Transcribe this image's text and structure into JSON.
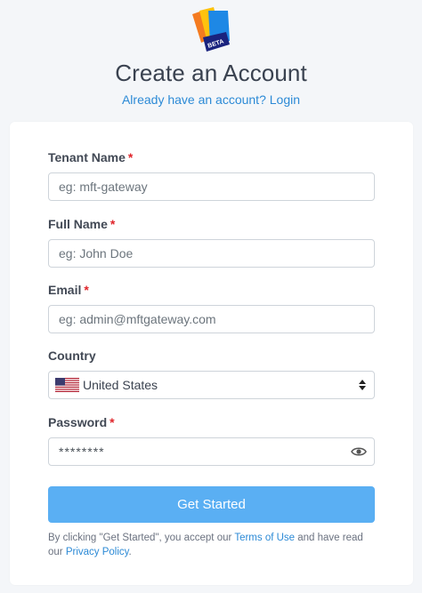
{
  "header": {
    "logo_badge": "BETA",
    "title": "Create an Account",
    "login_text": "Already have an account? Login"
  },
  "form": {
    "tenant": {
      "label": "Tenant Name",
      "required_mark": "*",
      "placeholder": "eg: mft-gateway",
      "value": ""
    },
    "fullname": {
      "label": "Full Name",
      "required_mark": "*",
      "placeholder": "eg: John Doe",
      "value": ""
    },
    "email": {
      "label": "Email",
      "required_mark": "*",
      "placeholder": "eg: admin@mftgateway.com",
      "value": ""
    },
    "country": {
      "label": "Country",
      "selected": "United States",
      "flag_icon": "us-flag-icon"
    },
    "password": {
      "label": "Password",
      "required_mark": "*",
      "placeholder": "********",
      "toggle_icon": "eye-icon"
    },
    "submit_label": "Get Started"
  },
  "terms": {
    "prefix": "By clicking \"Get Started\", you accept our ",
    "terms_link": "Terms of Use",
    "middle": " and have read our ",
    "privacy_link": "Privacy Policy",
    "suffix": "."
  },
  "colors": {
    "accent": "#2c8ad6",
    "button": "#5aaff3",
    "required": "#e0252b",
    "background": "#f4f6f9"
  }
}
